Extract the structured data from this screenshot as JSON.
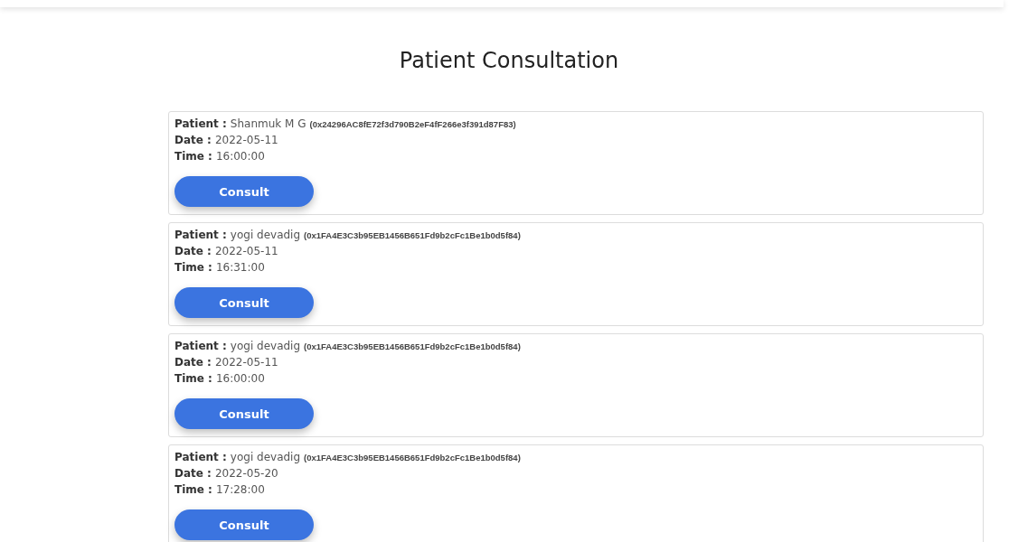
{
  "title": "Patient Consultation",
  "consultations": [
    {
      "patient_label": "Patient :",
      "patient": "Shanmuk M G",
      "address": "(0x24296AC8fE72f3d790B2eF4fF266e3f391d87F83)",
      "date_label": "Date :",
      "date": "2022-05-11",
      "time_label": "Time :",
      "time": "16:00:00",
      "button": "Consult"
    },
    {
      "patient_label": "Patient :",
      "patient": "yogi devadig",
      "address": "(0x1FA4E3C3b95EB1456B651Fd9b2cFc1Be1b0d5f84)",
      "date_label": "Date :",
      "date": "2022-05-11",
      "time_label": "Time :",
      "time": "16:31:00",
      "button": "Consult"
    },
    {
      "patient_label": "Patient :",
      "patient": "yogi devadig",
      "address": "(0x1FA4E3C3b95EB1456B651Fd9b2cFc1Be1b0d5f84)",
      "date_label": "Date :",
      "date": "2022-05-11",
      "time_label": "Time :",
      "time": "16:00:00",
      "button": "Consult"
    },
    {
      "patient_label": "Patient :",
      "patient": "yogi devadig",
      "address": "(0x1FA4E3C3b95EB1456B651Fd9b2cFc1Be1b0d5f84)",
      "date_label": "Date :",
      "date": "2022-05-20",
      "time_label": "Time :",
      "time": "17:28:00",
      "button": "Consult"
    }
  ]
}
